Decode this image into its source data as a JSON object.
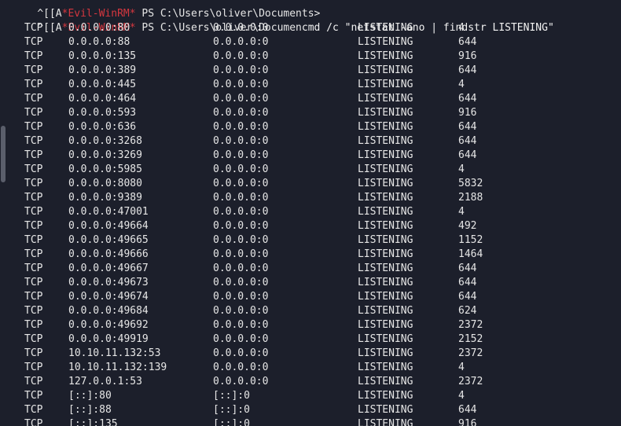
{
  "terminal": {
    "prompts": [
      {
        "escape": "^[[A",
        "shell_name": "*Evil-WinRM*",
        "ps_label": "PS",
        "path": "C:\\Users\\oliver\\Documents>",
        "command": ""
      },
      {
        "escape": "^[[A",
        "shell_name": "*Evil-WinRM*",
        "ps_label": "PS",
        "path": "C:\\Users\\oliver\\Documen",
        "command": "cmd /c \"netstat -ano | findstr LISTENING\""
      }
    ],
    "rows": [
      {
        "proto": "TCP",
        "local": "0.0.0.0:80",
        "foreign": "0.0.0.0:0",
        "state": "LISTENING",
        "pid": "4"
      },
      {
        "proto": "TCP",
        "local": "0.0.0.0:88",
        "foreign": "0.0.0.0:0",
        "state": "LISTENING",
        "pid": "644"
      },
      {
        "proto": "TCP",
        "local": "0.0.0.0:135",
        "foreign": "0.0.0.0:0",
        "state": "LISTENING",
        "pid": "916"
      },
      {
        "proto": "TCP",
        "local": "0.0.0.0:389",
        "foreign": "0.0.0.0:0",
        "state": "LISTENING",
        "pid": "644"
      },
      {
        "proto": "TCP",
        "local": "0.0.0.0:445",
        "foreign": "0.0.0.0:0",
        "state": "LISTENING",
        "pid": "4"
      },
      {
        "proto": "TCP",
        "local": "0.0.0.0:464",
        "foreign": "0.0.0.0:0",
        "state": "LISTENING",
        "pid": "644"
      },
      {
        "proto": "TCP",
        "local": "0.0.0.0:593",
        "foreign": "0.0.0.0:0",
        "state": "LISTENING",
        "pid": "916"
      },
      {
        "proto": "TCP",
        "local": "0.0.0.0:636",
        "foreign": "0.0.0.0:0",
        "state": "LISTENING",
        "pid": "644"
      },
      {
        "proto": "TCP",
        "local": "0.0.0.0:3268",
        "foreign": "0.0.0.0:0",
        "state": "LISTENING",
        "pid": "644"
      },
      {
        "proto": "TCP",
        "local": "0.0.0.0:3269",
        "foreign": "0.0.0.0:0",
        "state": "LISTENING",
        "pid": "644"
      },
      {
        "proto": "TCP",
        "local": "0.0.0.0:5985",
        "foreign": "0.0.0.0:0",
        "state": "LISTENING",
        "pid": "4"
      },
      {
        "proto": "TCP",
        "local": "0.0.0.0:8080",
        "foreign": "0.0.0.0:0",
        "state": "LISTENING",
        "pid": "5832"
      },
      {
        "proto": "TCP",
        "local": "0.0.0.0:9389",
        "foreign": "0.0.0.0:0",
        "state": "LISTENING",
        "pid": "2188"
      },
      {
        "proto": "TCP",
        "local": "0.0.0.0:47001",
        "foreign": "0.0.0.0:0",
        "state": "LISTENING",
        "pid": "4"
      },
      {
        "proto": "TCP",
        "local": "0.0.0.0:49664",
        "foreign": "0.0.0.0:0",
        "state": "LISTENING",
        "pid": "492"
      },
      {
        "proto": "TCP",
        "local": "0.0.0.0:49665",
        "foreign": "0.0.0.0:0",
        "state": "LISTENING",
        "pid": "1152"
      },
      {
        "proto": "TCP",
        "local": "0.0.0.0:49666",
        "foreign": "0.0.0.0:0",
        "state": "LISTENING",
        "pid": "1464"
      },
      {
        "proto": "TCP",
        "local": "0.0.0.0:49667",
        "foreign": "0.0.0.0:0",
        "state": "LISTENING",
        "pid": "644"
      },
      {
        "proto": "TCP",
        "local": "0.0.0.0:49673",
        "foreign": "0.0.0.0:0",
        "state": "LISTENING",
        "pid": "644"
      },
      {
        "proto": "TCP",
        "local": "0.0.0.0:49674",
        "foreign": "0.0.0.0:0",
        "state": "LISTENING",
        "pid": "644"
      },
      {
        "proto": "TCP",
        "local": "0.0.0.0:49684",
        "foreign": "0.0.0.0:0",
        "state": "LISTENING",
        "pid": "624"
      },
      {
        "proto": "TCP",
        "local": "0.0.0.0:49692",
        "foreign": "0.0.0.0:0",
        "state": "LISTENING",
        "pid": "2372"
      },
      {
        "proto": "TCP",
        "local": "0.0.0.0:49919",
        "foreign": "0.0.0.0:0",
        "state": "LISTENING",
        "pid": "2152"
      },
      {
        "proto": "TCP",
        "local": "10.10.11.132:53",
        "foreign": "0.0.0.0:0",
        "state": "LISTENING",
        "pid": "2372"
      },
      {
        "proto": "TCP",
        "local": "10.10.11.132:139",
        "foreign": "0.0.0.0:0",
        "state": "LISTENING",
        "pid": "4"
      },
      {
        "proto": "TCP",
        "local": "127.0.0.1:53",
        "foreign": "0.0.0.0:0",
        "state": "LISTENING",
        "pid": "2372"
      },
      {
        "proto": "TCP",
        "local": "[::]:80",
        "foreign": "[::]:0",
        "state": "LISTENING",
        "pid": "4"
      },
      {
        "proto": "TCP",
        "local": "[::]:88",
        "foreign": "[::]:0",
        "state": "LISTENING",
        "pid": "644"
      },
      {
        "proto": "TCP",
        "local": "[::]:135",
        "foreign": "[::]:0",
        "state": "LISTENING",
        "pid": "916"
      }
    ],
    "colors": {
      "background": "#1c1f2b",
      "foreground": "#e6e6e6",
      "shell_name": "#d5373f",
      "scrollbar_thumb": "#5a5e6b"
    }
  }
}
